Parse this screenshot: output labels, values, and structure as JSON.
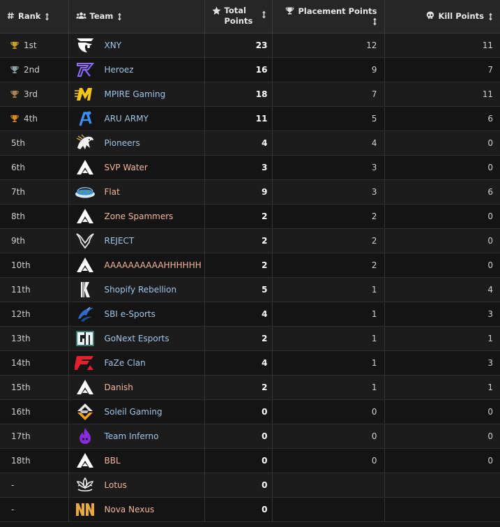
{
  "colors": {
    "background": "#171717",
    "header_bg": "#262626",
    "team_link_blue": "#9fc5e8",
    "team_link_salmon": "#f4b59a",
    "gold": "#c9a227",
    "silver": "#8fa3a8",
    "bronze": "#a88755"
  },
  "headers": {
    "rank": "Rank",
    "team": "Team",
    "total_line1": "Total",
    "total_line2": "Points",
    "placement": "Placement Points",
    "kill": "Kill Points"
  },
  "icons": {
    "rank": "hash-icon",
    "team": "users-icon",
    "total": "star-icon",
    "placement": "trophy-icon",
    "kill": "skull-icon",
    "sort": "sort-arrows-icon"
  },
  "rows": [
    {
      "rank": "1st",
      "team": "XNY",
      "total": "23",
      "placement": "12",
      "kill": "11",
      "trophy": "gold",
      "logo": "xny-logo",
      "link": "blue"
    },
    {
      "rank": "2nd",
      "team": "Heroez",
      "total": "16",
      "placement": "9",
      "kill": "7",
      "trophy": "silver",
      "logo": "heroez-logo",
      "link": "blue"
    },
    {
      "rank": "3rd",
      "team": "MPIRE Gaming",
      "total": "18",
      "placement": "7",
      "kill": "11",
      "trophy": "bronze",
      "logo": "mpire-logo",
      "link": "blue"
    },
    {
      "rank": "4th",
      "team": "ARU ARMY",
      "total": "11",
      "placement": "5",
      "kill": "6",
      "trophy": "orange",
      "logo": "aru-logo",
      "link": "blue"
    },
    {
      "rank": "5th",
      "team": "Pioneers",
      "total": "4",
      "placement": "4",
      "kill": "0",
      "trophy": "",
      "logo": "pioneers-logo",
      "link": "blue"
    },
    {
      "rank": "6th",
      "team": "SVP Water",
      "total": "3",
      "placement": "3",
      "kill": "0",
      "trophy": "",
      "logo": "apex-logo",
      "link": "salmon"
    },
    {
      "rank": "7th",
      "team": "Flat",
      "total": "9",
      "placement": "3",
      "kill": "6",
      "trophy": "",
      "logo": "flat-earth-logo",
      "link": "salmon"
    },
    {
      "rank": "8th",
      "team": "Zone Spammers",
      "total": "2",
      "placement": "2",
      "kill": "0",
      "trophy": "",
      "logo": "apex-logo",
      "link": "salmon"
    },
    {
      "rank": "9th",
      "team": "REJECT",
      "total": "2",
      "placement": "2",
      "kill": "0",
      "trophy": "",
      "logo": "reject-logo",
      "link": "blue"
    },
    {
      "rank": "10th",
      "team": "AAAAAAAAAAHHHHHH",
      "total": "2",
      "placement": "2",
      "kill": "0",
      "trophy": "",
      "logo": "apex-logo",
      "link": "salmon"
    },
    {
      "rank": "11th",
      "team": "Shopify Rebellion",
      "total": "5",
      "placement": "1",
      "kill": "4",
      "trophy": "",
      "logo": "shopify-rebellion-logo",
      "link": "blue"
    },
    {
      "rank": "12th",
      "team": "SBI e-Sports",
      "total": "4",
      "placement": "1",
      "kill": "3",
      "trophy": "",
      "logo": "sbi-logo",
      "link": "blue"
    },
    {
      "rank": "13th",
      "team": "GoNext Esports",
      "total": "2",
      "placement": "1",
      "kill": "1",
      "trophy": "",
      "logo": "gonext-logo",
      "link": "blue"
    },
    {
      "rank": "14th",
      "team": "FaZe Clan",
      "total": "4",
      "placement": "1",
      "kill": "3",
      "trophy": "",
      "logo": "faze-logo",
      "link": "blue"
    },
    {
      "rank": "15th",
      "team": "Danish",
      "total": "2",
      "placement": "1",
      "kill": "1",
      "trophy": "",
      "logo": "apex-logo",
      "link": "salmon"
    },
    {
      "rank": "16th",
      "team": "Soleil Gaming",
      "total": "0",
      "placement": "0",
      "kill": "0",
      "trophy": "",
      "logo": "soleil-logo",
      "link": "blue"
    },
    {
      "rank": "17th",
      "team": "Team Inferno",
      "total": "0",
      "placement": "0",
      "kill": "0",
      "trophy": "",
      "logo": "inferno-logo",
      "link": "blue"
    },
    {
      "rank": "18th",
      "team": "BBL",
      "total": "0",
      "placement": "0",
      "kill": "0",
      "trophy": "",
      "logo": "apex-logo",
      "link": "salmon"
    },
    {
      "rank": "-",
      "team": "Lotus",
      "total": "0",
      "placement": "",
      "kill": "",
      "trophy": "",
      "logo": "lotus-logo",
      "link": "salmon"
    },
    {
      "rank": "-",
      "team": "Nova Nexus",
      "total": "0",
      "placement": "",
      "kill": "",
      "trophy": "",
      "logo": "nova-nexus-logo",
      "link": "salmon"
    }
  ]
}
